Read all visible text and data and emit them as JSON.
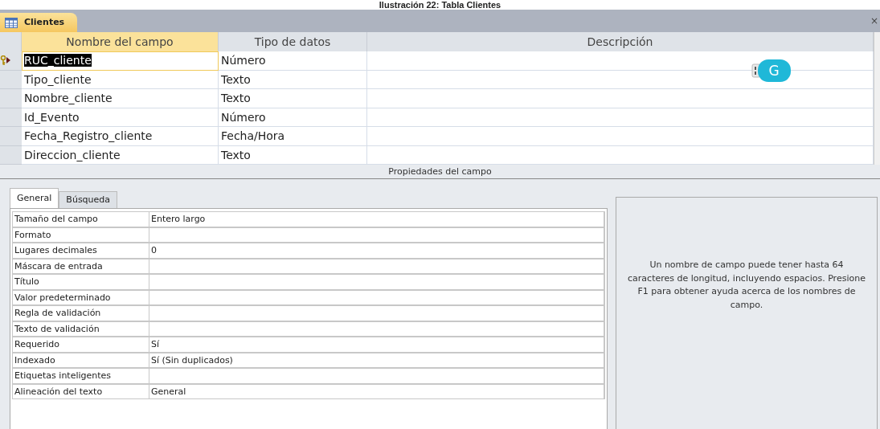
{
  "caption": "Ilustración 22: Tabla Clientes",
  "document_tab": {
    "title": "Clientes",
    "close": "×"
  },
  "columns": [
    "Nombre del campo",
    "Tipo de datos",
    "Descripción"
  ],
  "fields": [
    {
      "name": "RUC_cliente",
      "type": "Número",
      "description_overlay": "G",
      "selected": true,
      "primary_key": true
    },
    {
      "name": "Tipo_cliente",
      "type": "Texto",
      "selected": false,
      "primary_key": false
    },
    {
      "name": "Nombre_cliente",
      "type": "Texto",
      "selected": false,
      "primary_key": false
    },
    {
      "name": "Id_Evento",
      "type": "Número",
      "selected": false,
      "primary_key": false
    },
    {
      "name": "Fecha_Registro_cliente",
      "type": "Fecha/Hora",
      "selected": false,
      "primary_key": false
    },
    {
      "name": "Direccion_cliente",
      "type": "Texto",
      "selected": false,
      "primary_key": false
    }
  ],
  "properties_title": "Propiedades del campo",
  "property_tabs": [
    {
      "label": "General",
      "selected": true
    },
    {
      "label": "Búsqueda",
      "selected": false
    }
  ],
  "properties": [
    {
      "label": "Tamaño del campo",
      "value": "Entero largo"
    },
    {
      "label": "Formato"
    },
    {
      "label": "Lugares decimales",
      "value": "0"
    },
    {
      "label": "Máscara de entrada"
    },
    {
      "label": "Título"
    },
    {
      "label": "Valor predeterminado"
    },
    {
      "label": "Regla de validación"
    },
    {
      "label": "Texto de validación"
    },
    {
      "label": "Requerido",
      "value": "Sí"
    },
    {
      "label": "Indexado",
      "value": "Sí (Sin duplicados)"
    },
    {
      "label": "Etiquetas inteligentes"
    },
    {
      "label": "Alineación del texto",
      "value": "General"
    }
  ],
  "help_text": "Un nombre de campo puede tener hasta 64 caracteres de longitud, incluyendo espacios. Presione F1 para obtener ayuda acerca de los nombres de campo."
}
